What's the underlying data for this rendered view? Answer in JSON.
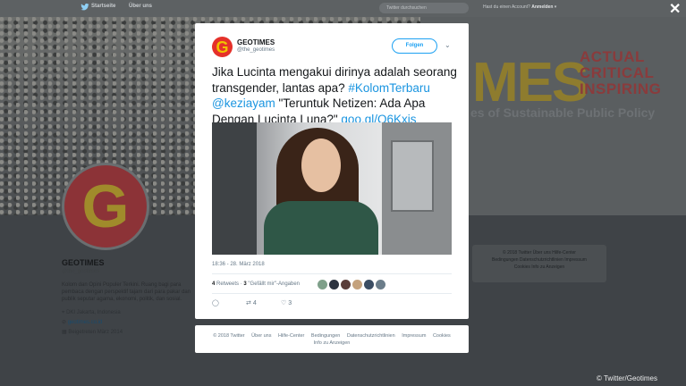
{
  "topbar": {
    "home": "Startseite",
    "about": "Über uns",
    "search_placeholder": "Twitter durchsuchen",
    "account_q": "Hast du einen Account?",
    "login": "Anmelden"
  },
  "banner": {
    "mes": "MES",
    "actual": "ACTUAL",
    "critical": "CRITICAL",
    "inspiring": "INSPIRING",
    "sustainable": "es of Sustainable Public Policy"
  },
  "profile": {
    "logo_letter": "G",
    "name": "GEOTIMES",
    "handle": "@the_geotimes",
    "bio": "Kolom dan Opini Populer Terkini. Ruang bagi para pembaca dengan perspektif tajam dari para pakar dan publik seputar agama, ekonomi, politik, dan sosial.",
    "location": "DKI Jakarta, Indonesia",
    "website": "geotimes.co.id",
    "joined": "Beigetreten März 2014"
  },
  "right_footer": {
    "line1": "© 2018 Twitter  Über uns  Hilfe-Center",
    "line2": "Bedingungen  Datenschutzrichtlinien  Impressum",
    "line3": "Cookies  Info zu Anzeigen"
  },
  "tweet": {
    "avatar_letter": "G",
    "name": "GEOTIMES",
    "handle": "@the_geotimes",
    "follow_label": "Folgen",
    "text_part1": "Jika Lucinta mengakui dirinya adalah seorang transgender, lantas apa? ",
    "hashtag": "#KolomTerbaru",
    "mention": "@keziayam",
    "text_part2": " \"Teruntuk Netizen: Ada Apa Dengan Lucinta Luna?\" ",
    "link": "goo.gl/Q6Kxjs",
    "timestamp": "18:36 - 28. März 2018",
    "retweets_count": "4",
    "retweets_label": "Retweets",
    "likes_count": "3",
    "likes_label": "\"Gefällt mir\"-Angaben",
    "reply_icon": "reply-icon",
    "retweet_icon": "retweet-icon",
    "like_icon": "heart-icon",
    "action_retweets": "4",
    "action_likes": "3"
  },
  "modal_footer": {
    "copyright": "© 2018 Twitter",
    "about": "Über uns",
    "help": "Hilfe-Center",
    "terms": "Bedingungen",
    "privacy": "Datenschutzrichtlinien",
    "imprint": "Impressum",
    "cookies": "Cookies",
    "ads": "Info zu Anzeigen"
  },
  "credit": "© Twitter/Geotimes",
  "colors": {
    "twitter_blue": "#1da1f2",
    "link_blue": "#1b95e0",
    "logo_red": "#e5312a",
    "logo_yellow": "#f0c200"
  }
}
